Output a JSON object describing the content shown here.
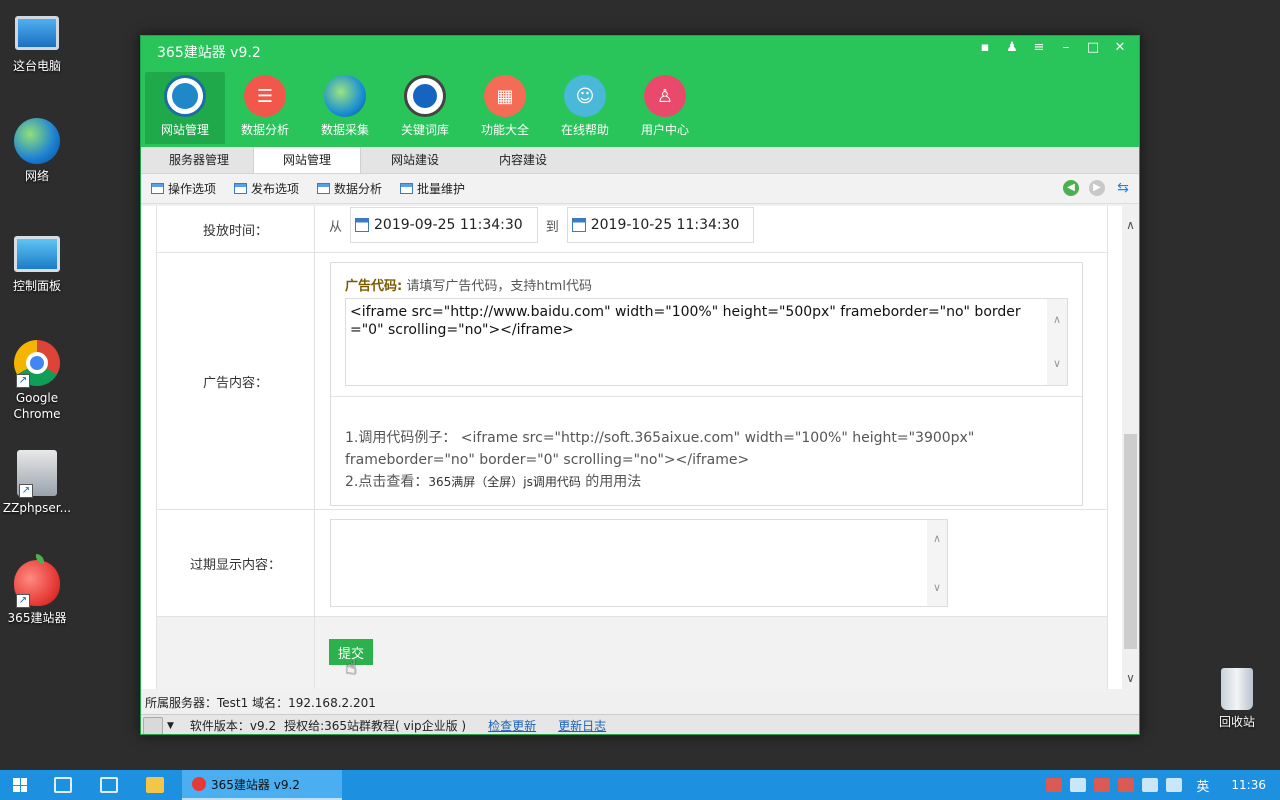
{
  "desktop": {
    "icons": [
      {
        "label": "这台电脑",
        "icon": "computer-icon"
      },
      {
        "label": "网络",
        "icon": "network-icon"
      },
      {
        "label": "控制面板",
        "icon": "control-panel-icon"
      },
      {
        "label": "Google Chrome",
        "icon": "chrome-icon"
      },
      {
        "label": "ZZphpser...",
        "icon": "zzphpserver-icon"
      },
      {
        "label": "365建站器",
        "icon": "apple-icon"
      },
      {
        "label": "回收站",
        "icon": "recycle-bin-icon"
      }
    ]
  },
  "window": {
    "title": "365建站器 v9.2",
    "controls": [
      "chat-icon",
      "shirt-icon",
      "menu-icon",
      "minimize-icon",
      "maximize-icon",
      "close-icon"
    ],
    "toolbar": [
      {
        "label": "网站管理",
        "icon": "monitor-icon",
        "active": true
      },
      {
        "label": "数据分析",
        "icon": "database-icon",
        "active": false
      },
      {
        "label": "数据采集",
        "icon": "globe-icon",
        "active": false
      },
      {
        "label": "关键词库",
        "icon": "book-icon",
        "active": false
      },
      {
        "label": "功能大全",
        "icon": "grid-icon",
        "active": false
      },
      {
        "label": "在线帮助",
        "icon": "headset-icon",
        "active": false
      },
      {
        "label": "用户中心",
        "icon": "user-icon",
        "active": false
      }
    ],
    "tabs": [
      {
        "label": "服务器管理",
        "active": false
      },
      {
        "label": "网站管理",
        "active": true
      },
      {
        "label": "网站建设",
        "active": false
      },
      {
        "label": "内容建设",
        "active": false
      }
    ],
    "subtoolbar": [
      "操作选项",
      "发布选项",
      "数据分析",
      "批量维护"
    ]
  },
  "form": {
    "time": {
      "label": "投放时间：",
      "from_label": "从",
      "from_value": "2019-09-25 11:34:30",
      "to_label": "到",
      "to_value": "2019-10-25 11:34:30"
    },
    "ad": {
      "label": "广告内容：",
      "hint_bold": "广告代码:",
      "hint_text": "请填写广告代码，支持html代码",
      "code": "<iframe src=\"http://www.baidu.com\" width=\"100%\" height=\"500px\" frameborder=\"no\" border=\"0\" scrolling=\"no\"></iframe>",
      "note1": "1.调用代码例子： <iframe src=\"http://soft.365aixue.com\" width=\"100%\" height=\"3900px\" frameborder=\"no\" border=\"0\" scrolling=\"no\"></iframe>",
      "note2_prefix": "2.点击查看：",
      "note2_link": "365满屏（全屏）js调用代码",
      "note2_suffix": " 的用用法"
    },
    "expire": {
      "label": "过期显示内容：",
      "value": ""
    },
    "submit_label": "提交"
  },
  "status": {
    "server_line": "所属服务器：Test1 域名：192.168.2.201",
    "version": "软件版本：v9.2",
    "license": "授权给:365站群教程( vip企业版 )",
    "check_update": "检查更新",
    "update_log": "更新日志"
  },
  "taskbar": {
    "task_label": "365建站器 v9.2",
    "lang": "英",
    "clock": "11:36"
  }
}
